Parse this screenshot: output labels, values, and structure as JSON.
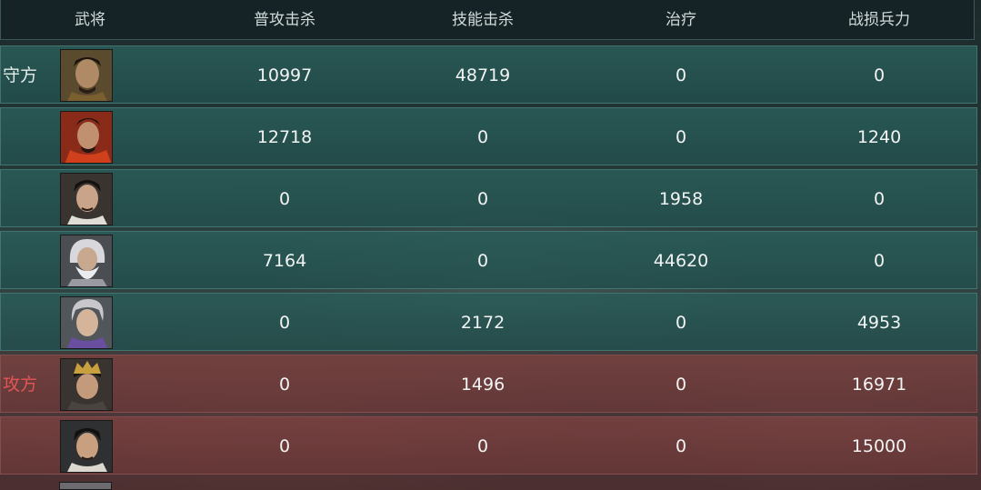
{
  "header": {
    "general": "武将",
    "normal_kills": "普攻击杀",
    "skill_kills": "技能击杀",
    "heal": "治疗",
    "losses": "战损兵力"
  },
  "rows": [
    {
      "side_label": "守方",
      "faction": "defender",
      "portrait_icon": "general-portrait-icon",
      "normal_kills": "10997",
      "skill_kills": "48719",
      "heal": "0",
      "losses": "0"
    },
    {
      "side_label": "",
      "faction": "defender",
      "portrait_icon": "general-portrait-icon",
      "normal_kills": "12718",
      "skill_kills": "0",
      "heal": "0",
      "losses": "1240"
    },
    {
      "side_label": "",
      "faction": "defender",
      "portrait_icon": "general-portrait-icon",
      "normal_kills": "0",
      "skill_kills": "0",
      "heal": "1958",
      "losses": "0"
    },
    {
      "side_label": "",
      "faction": "defender",
      "portrait_icon": "general-portrait-icon",
      "normal_kills": "7164",
      "skill_kills": "0",
      "heal": "44620",
      "losses": "0"
    },
    {
      "side_label": "",
      "faction": "defender",
      "portrait_icon": "general-portrait-icon",
      "normal_kills": "0",
      "skill_kills": "2172",
      "heal": "0",
      "losses": "4953"
    },
    {
      "side_label": "攻方",
      "faction": "attacker",
      "portrait_icon": "general-portrait-icon",
      "normal_kills": "0",
      "skill_kills": "1496",
      "heal": "0",
      "losses": "16971"
    },
    {
      "side_label": "",
      "faction": "attacker",
      "portrait_icon": "general-portrait-icon",
      "normal_kills": "0",
      "skill_kills": "0",
      "heal": "0",
      "losses": "15000"
    }
  ],
  "colors": {
    "defender_row": "#2a5c58",
    "attacker_row": "#7e4240",
    "attacker_label": "#e25555",
    "header_bg": "#152326"
  }
}
